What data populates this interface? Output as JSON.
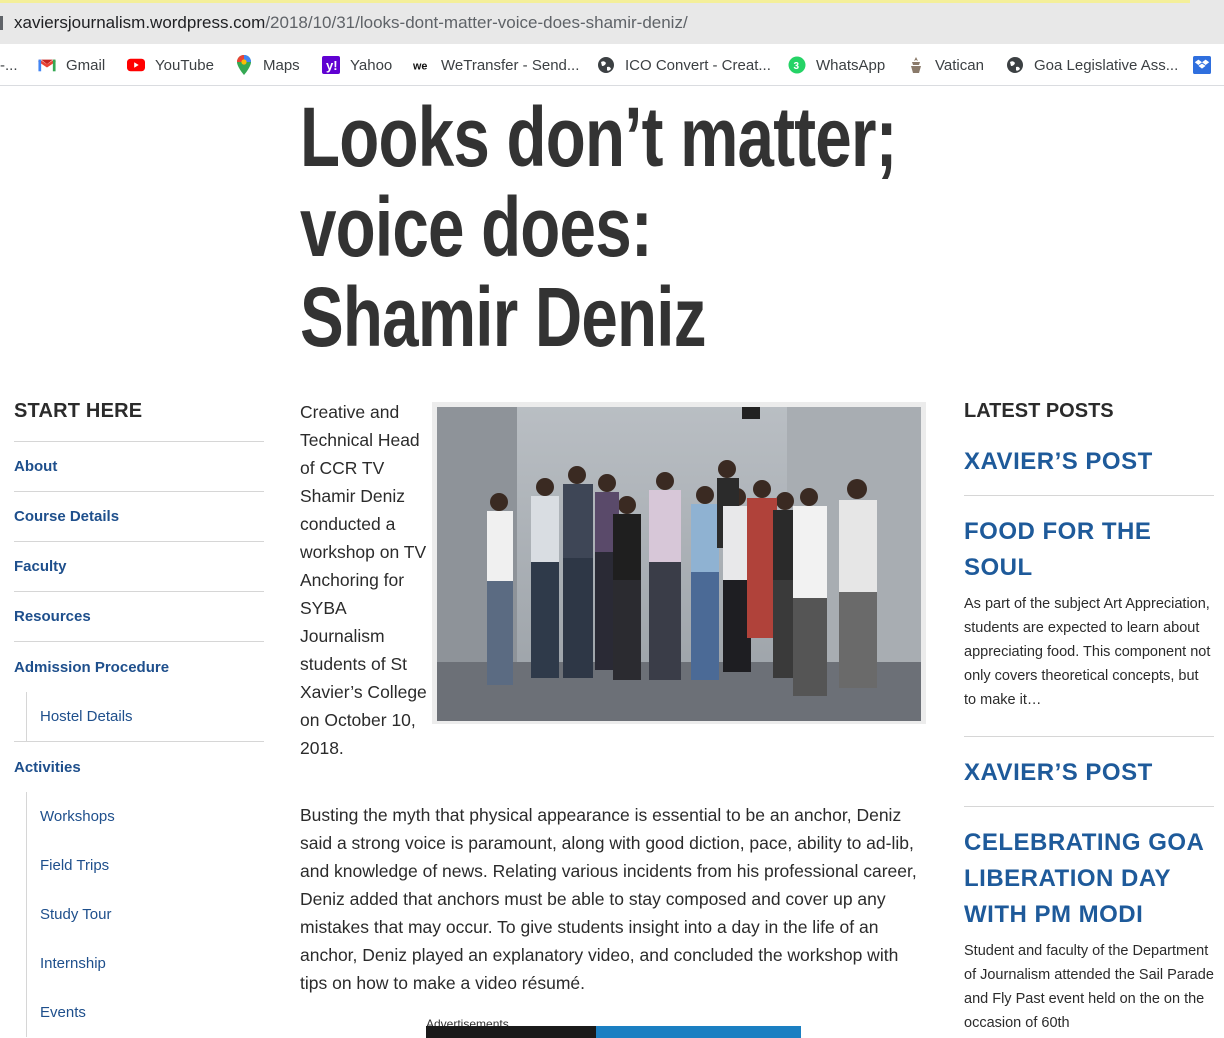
{
  "browser": {
    "url_domain": "xaviersjournalism.wordpress.com",
    "url_path": "/2018/10/31/looks-dont-matter-voice-does-shamir-deniz/",
    "bookmarks": [
      {
        "label": "-...",
        "icon": "truncated-bookmark"
      },
      {
        "label": "Gmail",
        "icon": "gmail-icon"
      },
      {
        "label": "YouTube",
        "icon": "youtube-icon"
      },
      {
        "label": "Maps",
        "icon": "maps-icon"
      },
      {
        "label": "Yahoo",
        "icon": "yahoo-icon"
      },
      {
        "label": "WeTransfer - Send...",
        "icon": "wetransfer-icon"
      },
      {
        "label": "ICO Convert - Creat...",
        "icon": "globe-icon"
      },
      {
        "label": "WhatsApp",
        "icon": "whatsapp-icon"
      },
      {
        "label": "Vatican",
        "icon": "vatican-icon"
      },
      {
        "label": "Goa Legislative Ass...",
        "icon": "globe-icon"
      },
      {
        "label": "",
        "icon": "dropbox-icon"
      }
    ]
  },
  "post": {
    "title_line1": "Looks don’t matter;",
    "title_line2": "voice does:",
    "title_line3": "Shamir Deniz",
    "lead_paragraph": "Creative and Technical Head of CCR TV Shamir Deniz conducted a workshop on TV Anchoring for SYBA Journalism students of St Xavier’s College on October 10, 2018.",
    "body_paragraph": "Busting the myth that physical appearance is essential to be an anchor, Deniz said a strong voice is paramount, along with good diction, pace, ability to ad-lib, and knowledge of news. Relating various incidents from his professional career, Deniz added that anchors must be able to stay composed and cover up any mistakes that may occur. To give students insight into a day in the life of an anchor, Deniz played an explanatory video, and concluded the workshop with tips on how to make a video résumé.",
    "advertisements_label": "Advertisements"
  },
  "left_nav": {
    "title": "START HERE",
    "items": [
      {
        "label": "About"
      },
      {
        "label": "Course Details"
      },
      {
        "label": "Faculty"
      },
      {
        "label": "Resources"
      },
      {
        "label": "Admission Procedure"
      }
    ],
    "admission_sub": [
      {
        "label": "Hostel Details"
      }
    ],
    "activities_label": "Activities",
    "activities_sub": [
      {
        "label": "Workshops"
      },
      {
        "label": "Field Trips"
      },
      {
        "label": "Study Tour"
      },
      {
        "label": "Internship"
      },
      {
        "label": "Events"
      }
    ]
  },
  "right_sidebar": {
    "title": "LATEST POSTS",
    "posts": [
      {
        "title": "XAVIER’S POST",
        "excerpt": ""
      },
      {
        "title": "FOOD FOR THE SOUL",
        "excerpt": "As part of the subject Art Appreciation, students are expected to learn about appreciating food. This component not only covers theoretical concepts, but to make it…"
      },
      {
        "title": "XAVIER’S POST",
        "excerpt": ""
      },
      {
        "title": "CELEBRATING GOA LIBERATION DAY WITH PM MODI",
        "excerpt": "Student and faculty of the Department of Journalism attended the Sail Parade and Fly Past event held on the on the occasion of 60th"
      }
    ]
  },
  "colors": {
    "link_blue": "#1e4f8c",
    "sidebar_post_blue": "#1e5a9a",
    "title_gray": "#333333"
  }
}
